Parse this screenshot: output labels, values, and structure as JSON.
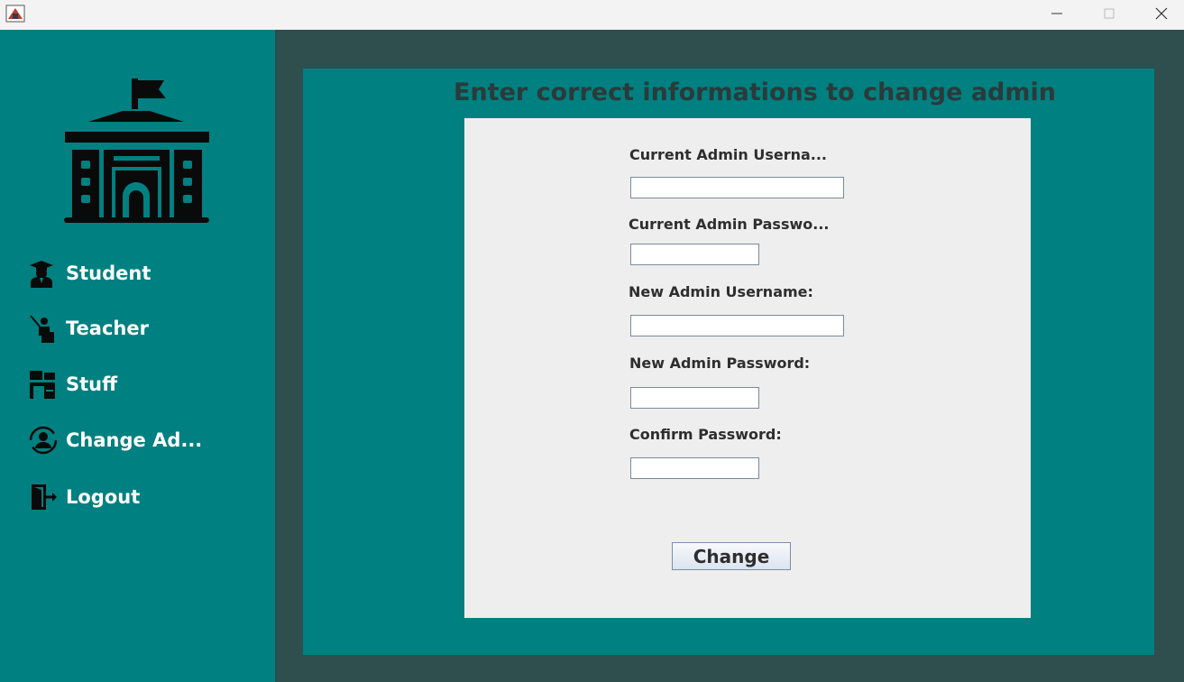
{
  "window": {
    "icons": {
      "app": "java-app-icon",
      "minimize": "minimize-icon",
      "maximize": "maximize-icon",
      "close": "close-icon"
    }
  },
  "sidebar": {
    "logo_icon": "school-building-icon",
    "items": [
      {
        "label": "Student",
        "icon": "student-graduate-icon"
      },
      {
        "label": "Teacher",
        "icon": "teacher-pointer-icon"
      },
      {
        "label": "Stuff",
        "icon": "staff-desk-icon"
      },
      {
        "label": "Change Ad...",
        "icon": "change-admin-icon"
      },
      {
        "label": "Logout",
        "icon": "logout-door-icon"
      }
    ]
  },
  "main": {
    "title": "Enter correct informations to change admin",
    "form": {
      "fields": [
        {
          "label": "Current Admin Userna...",
          "value": ""
        },
        {
          "label": "Current Admin Passwo...",
          "value": ""
        },
        {
          "label": "New Admin Username:",
          "value": ""
        },
        {
          "label": "New Admin Password:",
          "value": ""
        },
        {
          "label": "Confirm Password:",
          "value": ""
        }
      ],
      "submit_label": "Change"
    }
  },
  "colors": {
    "teal": "#008080",
    "dark_slate": "#2f4f4f",
    "card": "#eeeeee",
    "titlebar": "#f3f3f3"
  }
}
